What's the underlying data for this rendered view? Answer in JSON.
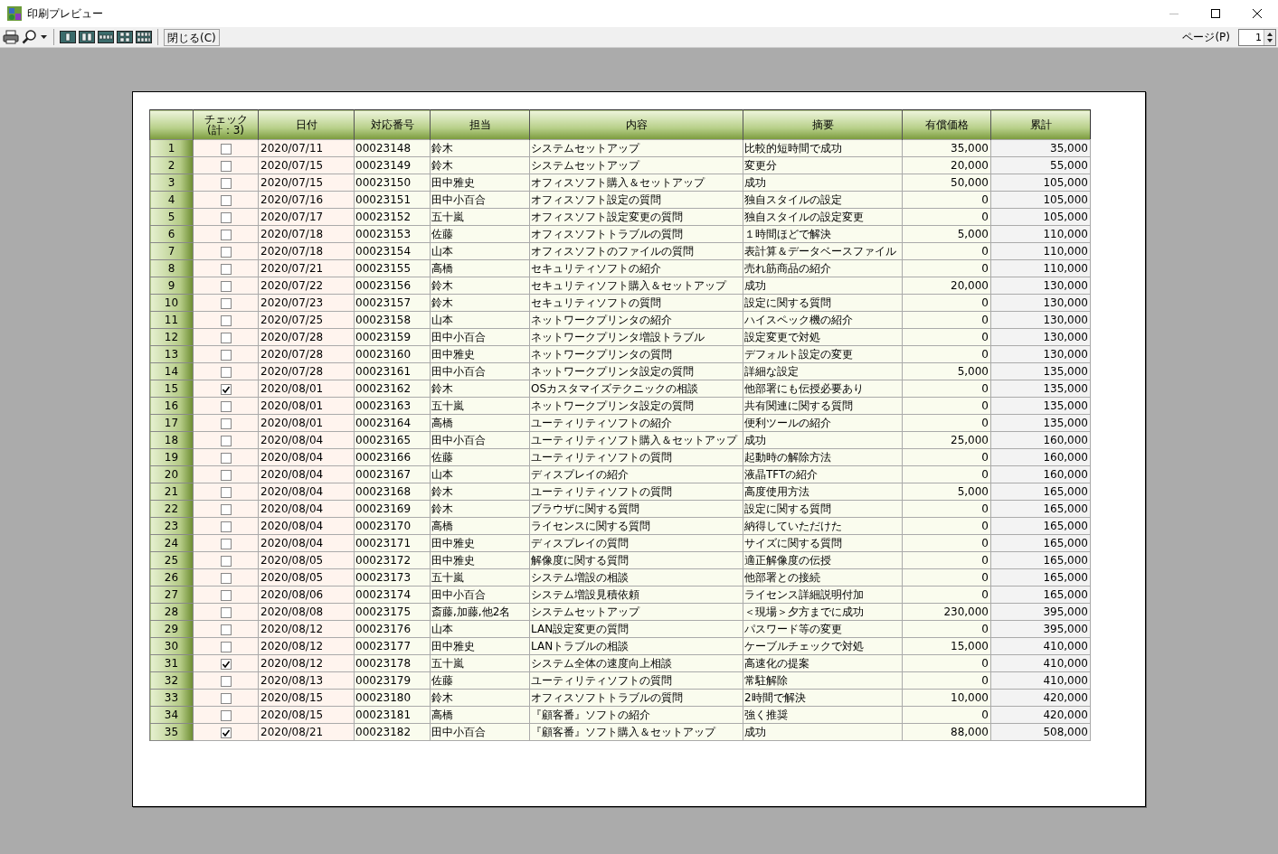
{
  "window": {
    "title": "印刷プレビュー"
  },
  "toolbar": {
    "close_button": "閉じる(C)",
    "page_label": "ページ(P)",
    "page_value": "1"
  },
  "table": {
    "columns": [
      "",
      "チェック\n(計：3)",
      "日付",
      "対応番号",
      "担当",
      "内容",
      "摘要",
      "有償価格",
      "累計"
    ],
    "rows": [
      {
        "no": "1",
        "checked": false,
        "date": "2020/07/11",
        "number": "00023148",
        "staff": "鈴木",
        "content": "システムセットアップ",
        "summary": "比較的短時間で成功",
        "price": "35,000",
        "total": "35,000"
      },
      {
        "no": "2",
        "checked": false,
        "date": "2020/07/15",
        "number": "00023149",
        "staff": "鈴木",
        "content": "システムセットアップ",
        "summary": "変更分",
        "price": "20,000",
        "total": "55,000"
      },
      {
        "no": "3",
        "checked": false,
        "date": "2020/07/15",
        "number": "00023150",
        "staff": "田中雅史",
        "content": "オフィスソフト購入＆セットアップ",
        "summary": "成功",
        "price": "50,000",
        "total": "105,000"
      },
      {
        "no": "4",
        "checked": false,
        "date": "2020/07/16",
        "number": "00023151",
        "staff": "田中小百合",
        "content": "オフィスソフト設定の質問",
        "summary": "独自スタイルの設定",
        "price": "0",
        "total": "105,000"
      },
      {
        "no": "5",
        "checked": false,
        "date": "2020/07/17",
        "number": "00023152",
        "staff": "五十嵐",
        "content": "オフィスソフト設定変更の質問",
        "summary": "独自スタイルの設定変更",
        "price": "0",
        "total": "105,000"
      },
      {
        "no": "6",
        "checked": false,
        "date": "2020/07/18",
        "number": "00023153",
        "staff": "佐藤",
        "content": "オフィスソフトトラブルの質問",
        "summary": "１時間ほどで解決",
        "price": "5,000",
        "total": "110,000"
      },
      {
        "no": "7",
        "checked": false,
        "date": "2020/07/18",
        "number": "00023154",
        "staff": "山本",
        "content": "オフィスソフトのファイルの質問",
        "summary": "表計算＆データベースファイル",
        "price": "0",
        "total": "110,000"
      },
      {
        "no": "8",
        "checked": false,
        "date": "2020/07/21",
        "number": "00023155",
        "staff": "高橋",
        "content": "セキュリティソフトの紹介",
        "summary": "売れ筋商品の紹介",
        "price": "0",
        "total": "110,000"
      },
      {
        "no": "9",
        "checked": false,
        "date": "2020/07/22",
        "number": "00023156",
        "staff": "鈴木",
        "content": "セキュリティソフト購入＆セットアップ",
        "summary": "成功",
        "price": "20,000",
        "total": "130,000"
      },
      {
        "no": "10",
        "checked": false,
        "date": "2020/07/23",
        "number": "00023157",
        "staff": "鈴木",
        "content": "セキュリティソフトの質問",
        "summary": "設定に関する質問",
        "price": "0",
        "total": "130,000"
      },
      {
        "no": "11",
        "checked": false,
        "date": "2020/07/25",
        "number": "00023158",
        "staff": "山本",
        "content": "ネットワークプリンタの紹介",
        "summary": "ハイスペック機の紹介",
        "price": "0",
        "total": "130,000"
      },
      {
        "no": "12",
        "checked": false,
        "date": "2020/07/28",
        "number": "00023159",
        "staff": "田中小百合",
        "content": "ネットワークプリンタ増設トラブル",
        "summary": "設定変更で対処",
        "price": "0",
        "total": "130,000"
      },
      {
        "no": "13",
        "checked": false,
        "date": "2020/07/28",
        "number": "00023160",
        "staff": "田中雅史",
        "content": "ネットワークプリンタの質問",
        "summary": "デフォルト設定の変更",
        "price": "0",
        "total": "130,000"
      },
      {
        "no": "14",
        "checked": false,
        "date": "2020/07/28",
        "number": "00023161",
        "staff": "田中小百合",
        "content": "ネットワークプリンタ設定の質問",
        "summary": "詳細な設定",
        "price": "5,000",
        "total": "135,000"
      },
      {
        "no": "15",
        "checked": true,
        "date": "2020/08/01",
        "number": "00023162",
        "staff": "鈴木",
        "content": "OSカスタマイズテクニックの相談",
        "summary": "他部署にも伝授必要あり",
        "price": "0",
        "total": "135,000"
      },
      {
        "no": "16",
        "checked": false,
        "date": "2020/08/01",
        "number": "00023163",
        "staff": "五十嵐",
        "content": "ネットワークプリンタ設定の質問",
        "summary": "共有関連に関する質問",
        "price": "0",
        "total": "135,000"
      },
      {
        "no": "17",
        "checked": false,
        "date": "2020/08/01",
        "number": "00023164",
        "staff": "高橋",
        "content": "ユーティリティソフトの紹介",
        "summary": "便利ツールの紹介",
        "price": "0",
        "total": "135,000"
      },
      {
        "no": "18",
        "checked": false,
        "date": "2020/08/04",
        "number": "00023165",
        "staff": "田中小百合",
        "content": "ユーティリティソフト購入＆セットアップ",
        "summary": "成功",
        "price": "25,000",
        "total": "160,000"
      },
      {
        "no": "19",
        "checked": false,
        "date": "2020/08/04",
        "number": "00023166",
        "staff": "佐藤",
        "content": "ユーティリティソフトの質問",
        "summary": "起動時の解除方法",
        "price": "0",
        "total": "160,000"
      },
      {
        "no": "20",
        "checked": false,
        "date": "2020/08/04",
        "number": "00023167",
        "staff": "山本",
        "content": "ディスプレイの紹介",
        "summary": "液晶TFTの紹介",
        "price": "0",
        "total": "160,000"
      },
      {
        "no": "21",
        "checked": false,
        "date": "2020/08/04",
        "number": "00023168",
        "staff": "鈴木",
        "content": "ユーティリティソフトの質問",
        "summary": "高度使用方法",
        "price": "5,000",
        "total": "165,000"
      },
      {
        "no": "22",
        "checked": false,
        "date": "2020/08/04",
        "number": "00023169",
        "staff": "鈴木",
        "content": "ブラウザに関する質問",
        "summary": "設定に関する質問",
        "price": "0",
        "total": "165,000"
      },
      {
        "no": "23",
        "checked": false,
        "date": "2020/08/04",
        "number": "00023170",
        "staff": "高橋",
        "content": "ライセンスに関する質問",
        "summary": "納得していただけた",
        "price": "0",
        "total": "165,000"
      },
      {
        "no": "24",
        "checked": false,
        "date": "2020/08/04",
        "number": "00023171",
        "staff": "田中雅史",
        "content": "ディスプレイの質問",
        "summary": "サイズに関する質問",
        "price": "0",
        "total": "165,000"
      },
      {
        "no": "25",
        "checked": false,
        "date": "2020/08/05",
        "number": "00023172",
        "staff": "田中雅史",
        "content": "解像度に関する質問",
        "summary": "適正解像度の伝授",
        "price": "0",
        "total": "165,000"
      },
      {
        "no": "26",
        "checked": false,
        "date": "2020/08/05",
        "number": "00023173",
        "staff": "五十嵐",
        "content": "システム増設の相談",
        "summary": "他部署との接続",
        "price": "0",
        "total": "165,000"
      },
      {
        "no": "27",
        "checked": false,
        "date": "2020/08/06",
        "number": "00023174",
        "staff": "田中小百合",
        "content": "システム増設見積依頼",
        "summary": "ライセンス詳細説明付加",
        "price": "0",
        "total": "165,000"
      },
      {
        "no": "28",
        "checked": false,
        "date": "2020/08/08",
        "number": "00023175",
        "staff": "斎藤,加藤,他2名",
        "content": "システムセットアップ",
        "summary": "＜現場＞夕方までに成功",
        "price": "230,000",
        "total": "395,000"
      },
      {
        "no": "29",
        "checked": false,
        "date": "2020/08/12",
        "number": "00023176",
        "staff": "山本",
        "content": "LAN設定変更の質問",
        "summary": "パスワード等の変更",
        "price": "0",
        "total": "395,000"
      },
      {
        "no": "30",
        "checked": false,
        "date": "2020/08/12",
        "number": "00023177",
        "staff": "田中雅史",
        "content": "LANトラブルの相談",
        "summary": "ケーブルチェックで対処",
        "price": "15,000",
        "total": "410,000"
      },
      {
        "no": "31",
        "checked": true,
        "date": "2020/08/12",
        "number": "00023178",
        "staff": "五十嵐",
        "content": "システム全体の速度向上相談",
        "summary": "高速化の提案",
        "price": "0",
        "total": "410,000"
      },
      {
        "no": "32",
        "checked": false,
        "date": "2020/08/13",
        "number": "00023179",
        "staff": "佐藤",
        "content": "ユーティリティソフトの質問",
        "summary": "常駐解除",
        "price": "0",
        "total": "410,000"
      },
      {
        "no": "33",
        "checked": false,
        "date": "2020/08/15",
        "number": "00023180",
        "staff": "鈴木",
        "content": "オフィスソフトトラブルの質問",
        "summary": "2時間で解決",
        "price": "10,000",
        "total": "420,000"
      },
      {
        "no": "34",
        "checked": false,
        "date": "2020/08/15",
        "number": "00023181",
        "staff": "高橋",
        "content": "『顧客番』ソフトの紹介",
        "summary": "強く推奨",
        "price": "0",
        "total": "420,000"
      },
      {
        "no": "35",
        "checked": true,
        "date": "2020/08/21",
        "number": "00023182",
        "staff": "田中小百合",
        "content": "『顧客番』ソフト購入＆セットアップ",
        "summary": "成功",
        "price": "88,000",
        "total": "508,000"
      }
    ]
  }
}
